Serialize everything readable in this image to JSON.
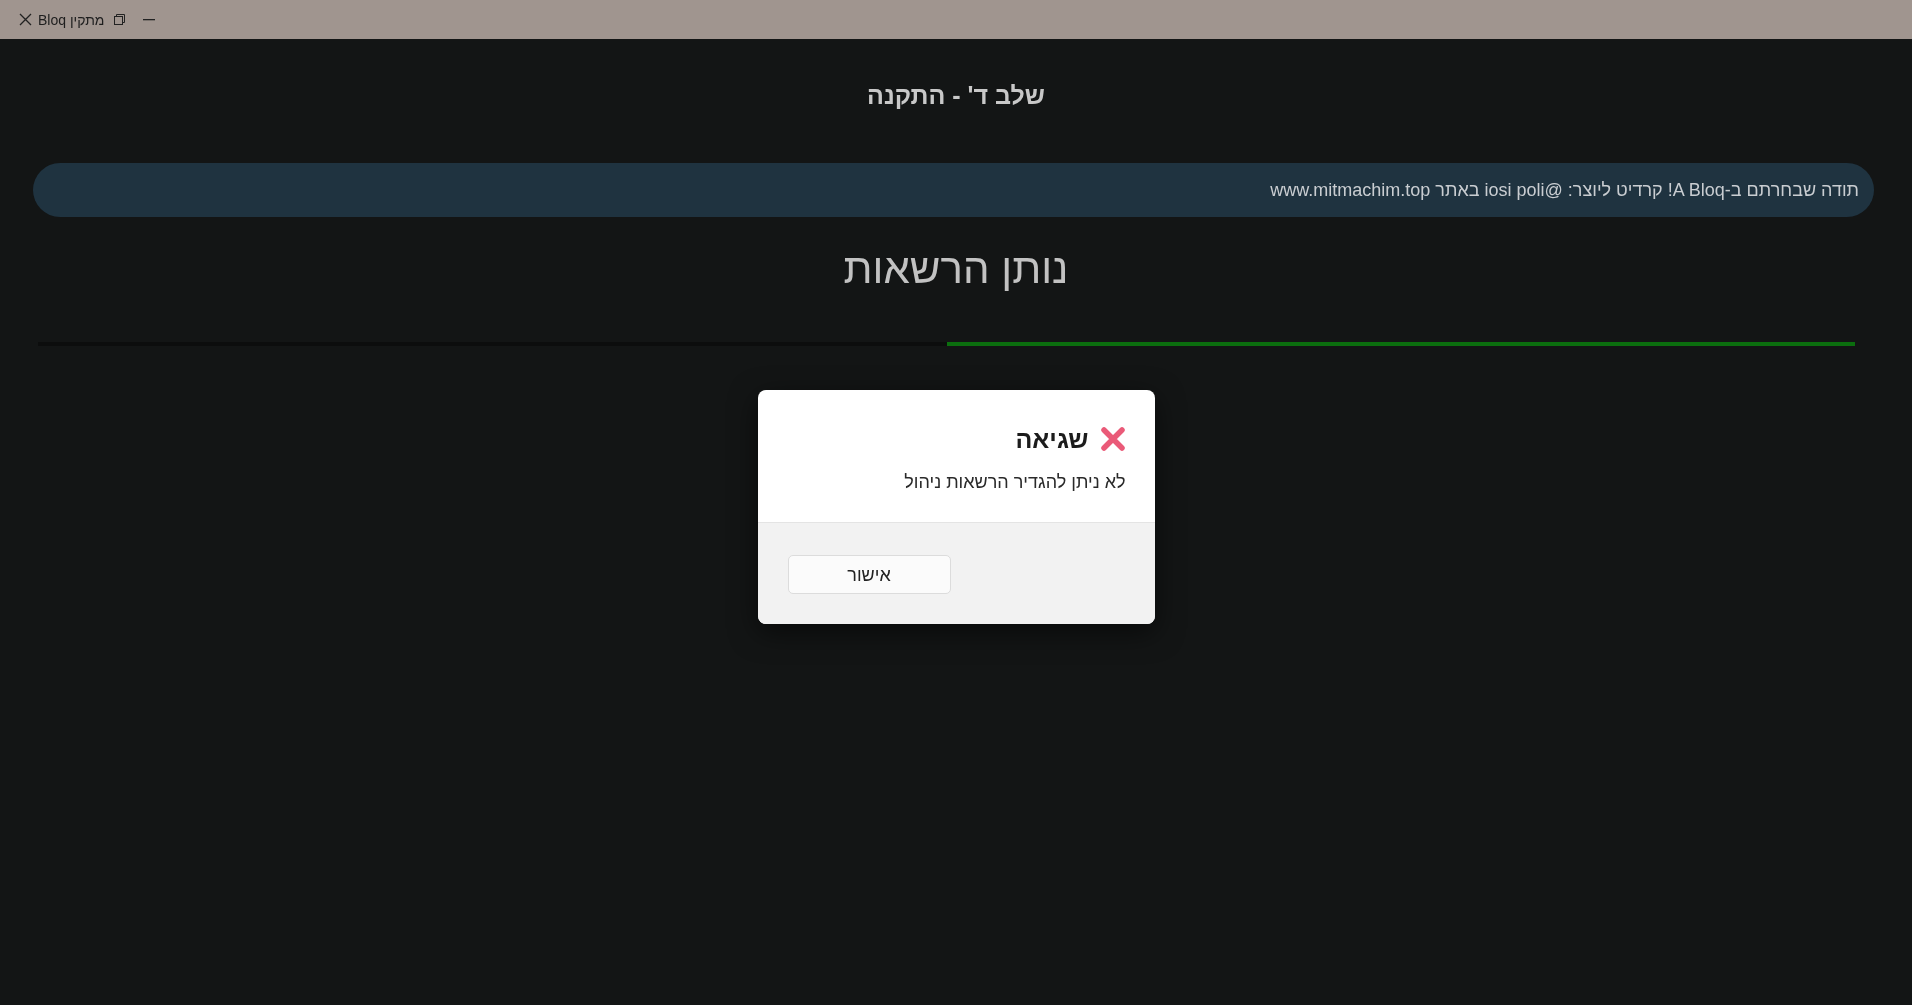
{
  "window": {
    "title": "מתקין Bloq"
  },
  "step": {
    "title": "שלב ד' - התקנה"
  },
  "banner": {
    "text": "תודה שבחרתם ב-A Bloq! קרדיט ליוצר: @iosi poli באתר www.mitmachim.top"
  },
  "stage": {
    "title": "נותן הרשאות",
    "progress": {
      "level": 0.5
    }
  },
  "dialog": {
    "kind": "error",
    "title": "שגיאה",
    "message": "לא ניתן להגדיר הרשאות ניהול",
    "buttons": [
      "אישור"
    ]
  }
}
